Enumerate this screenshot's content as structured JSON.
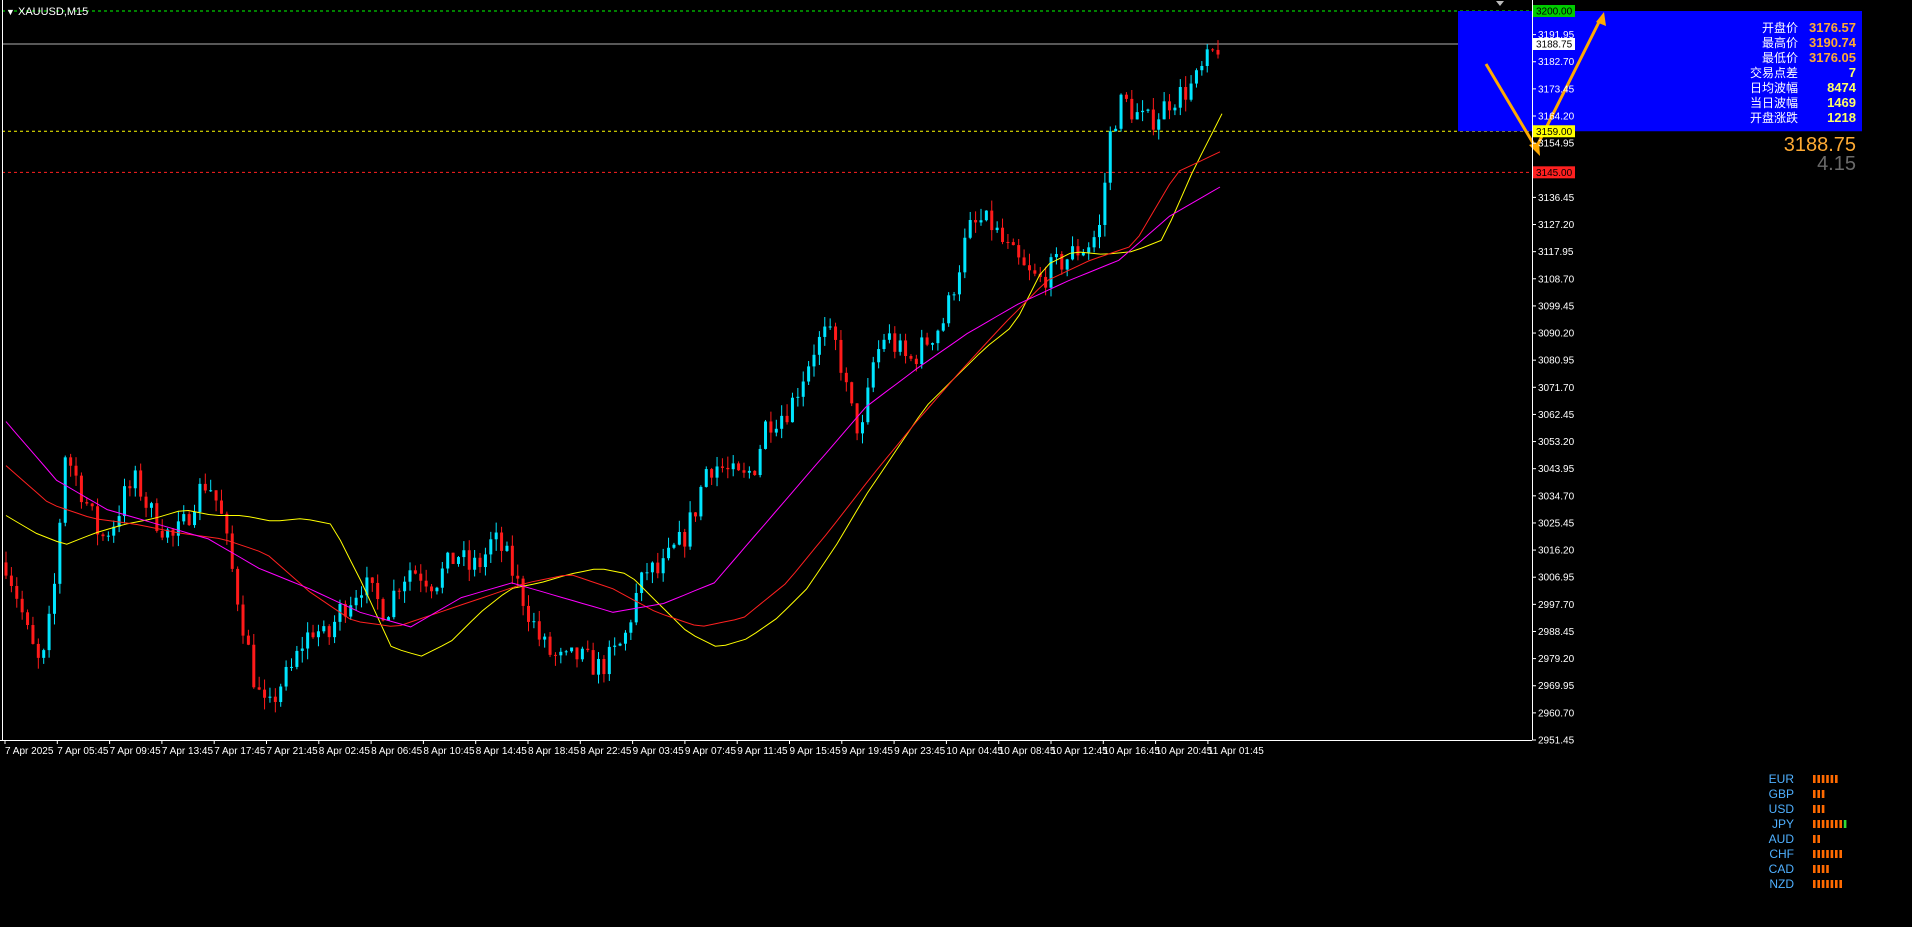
{
  "chart_data": {
    "type": "candlestick",
    "title": "XAUUSD,M15",
    "symbol": "XAUUSD",
    "timeframe": "M15",
    "ylim": [
      2951.45,
      3200.0
    ],
    "price_ticks": [
      "3191.95",
      "3182.70",
      "3173.45",
      "3164.20",
      "3154.95",
      "3136.45",
      "3127.20",
      "3117.95",
      "3108.70",
      "3099.45",
      "3090.20",
      "3080.95",
      "3071.70",
      "3062.45",
      "3053.20",
      "3043.95",
      "3034.70",
      "3025.45",
      "3016.20",
      "3006.95",
      "2997.70",
      "2988.45",
      "2979.20",
      "2969.95",
      "2960.70",
      "2951.45"
    ],
    "time_ticks": [
      "7 Apr 2025",
      "7 Apr 05:45",
      "7 Apr 09:45",
      "7 Apr 13:45",
      "7 Apr 17:45",
      "7 Apr 21:45",
      "8 Apr 02:45",
      "8 Apr 06:45",
      "8 Apr 10:45",
      "8 Apr 14:45",
      "8 Apr 18:45",
      "8 Apr 22:45",
      "9 Apr 03:45",
      "9 Apr 07:45",
      "9 Apr 11:45",
      "9 Apr 15:45",
      "9 Apr 19:45",
      "9 Apr 23:45",
      "10 Apr 04:45",
      "10 Apr 08:45",
      "10 Apr 12:45",
      "10 Apr 16:45",
      "10 Apr 20:45",
      "11 Apr 01:45"
    ],
    "price_path": [
      3012,
      3000,
      2985,
      2975,
      3000,
      3050,
      3040,
      3030,
      3020,
      3025,
      3035,
      3040,
      3030,
      3025,
      3020,
      3025,
      3035,
      3040,
      3030,
      3010,
      2990,
      2970,
      2960,
      2970,
      2975,
      2985,
      2990,
      2985,
      2995,
      3000,
      3005,
      3000,
      2995,
      3005,
      3010,
      3008,
      3005,
      3010,
      3015,
      3010,
      3012,
      3020,
      3015,
      3005,
      2995,
      2985,
      2980,
      2978,
      2980,
      2978,
      2976,
      2980,
      2985,
      3000,
      3010,
      3008,
      3015,
      3020,
      3030,
      3045,
      3045,
      3042,
      3040,
      3045,
      3060,
      3062,
      3065,
      3075,
      3085,
      3090,
      3085,
      3065,
      3055,
      3080,
      3090,
      3085,
      3080,
      3085,
      3090,
      3095,
      3110,
      3125,
      3128,
      3127,
      3120,
      3115,
      3110,
      3108,
      3112,
      3115,
      3118,
      3120,
      3125,
      3160,
      3170,
      3165,
      3162,
      3165,
      3170,
      3172,
      3175,
      3182,
      3188
    ],
    "candle_count": 226,
    "ma_fast_path": [
      3028,
      3022,
      3018,
      3022,
      3025,
      3027,
      3030,
      3028,
      3028,
      3026,
      3027,
      3025,
      3005,
      2983,
      2980,
      2985,
      2995,
      3003,
      3005,
      3008,
      3010,
      3008,
      2998,
      2988,
      2983,
      2986,
      2993,
      3003,
      3018,
      3035,
      3050,
      3065,
      3075,
      3085,
      3093,
      3113,
      3118,
      3117,
      3118,
      3122,
      3145,
      3165
    ],
    "ma_mid_path": [
      3045,
      3032,
      3027,
      3025,
      3022,
      3020,
      3015,
      3002,
      2992,
      2990,
      2995,
      3000,
      3005,
      3008,
      3003,
      2995,
      2990,
      2993,
      3005,
      3023,
      3042,
      3060,
      3077,
      3093,
      3108,
      3115,
      3120,
      3145,
      3152
    ],
    "ma_slow_path": [
      3060,
      3040,
      3030,
      3025,
      3020,
      3010,
      3003,
      2995,
      2990,
      3000,
      3005,
      3000,
      2995,
      2998,
      3005,
      3025,
      3045,
      3065,
      3078,
      3090,
      3100,
      3108,
      3115,
      3130,
      3140
    ],
    "levels": [
      {
        "price": 3200.0,
        "label": "3200.00",
        "line_color": "#00ff00",
        "tag_color": "#00cc00"
      },
      {
        "price": 3188.75,
        "label": "3188.75",
        "line_color": "#b0b0b0",
        "tag_color": "#ffffff"
      },
      {
        "price": 3159.0,
        "label": "3159.00",
        "line_color": "#ffff00",
        "tag_color": "#ffff00"
      },
      {
        "price": 3145.0,
        "label": "3145.00",
        "line_color": "#ff2020",
        "tag_color": "#ff2020"
      }
    ],
    "colors": {
      "bull": "#00e5ff",
      "bear": "#ff1a1a",
      "ma_fast": "#ffff00",
      "ma_mid": "#ff2020",
      "ma_slow": "#ff00ff",
      "arrow": "#ffaa00",
      "panel": "#0000ff",
      "grid": "none"
    }
  },
  "info_panel": {
    "rows": [
      {
        "label": "开盘价",
        "value": "3176.57",
        "color": "#ffaa33"
      },
      {
        "label": "最高价",
        "value": "3190.74",
        "color": "#ffaa33"
      },
      {
        "label": "最低价",
        "value": "3176.05",
        "color": "#ffaa33"
      },
      {
        "label": "交易点差",
        "value": "7",
        "color": "#ffff66"
      },
      {
        "label": "日均波幅",
        "value": "8474",
        "color": "#ffff66"
      },
      {
        "label": "当日波幅",
        "value": "1469",
        "color": "#ffff66"
      },
      {
        "label": "开盘涨跌",
        "value": "1218",
        "color": "#ffff66"
      }
    ],
    "current_price": "3188.75",
    "change": "4.15"
  },
  "currency_strength": [
    {
      "code": "EUR",
      "bars": 6,
      "green": 0
    },
    {
      "code": "GBP",
      "bars": 3,
      "green": 0
    },
    {
      "code": "USD",
      "bars": 3,
      "green": 0
    },
    {
      "code": "JPY",
      "bars": 8,
      "green": 1
    },
    {
      "code": "AUD",
      "bars": 2,
      "green": 0
    },
    {
      "code": "CHF",
      "bars": 7,
      "green": 0
    },
    {
      "code": "CAD",
      "bars": 4,
      "green": 0
    },
    {
      "code": "NZD",
      "bars": 7,
      "green": 0
    }
  ]
}
